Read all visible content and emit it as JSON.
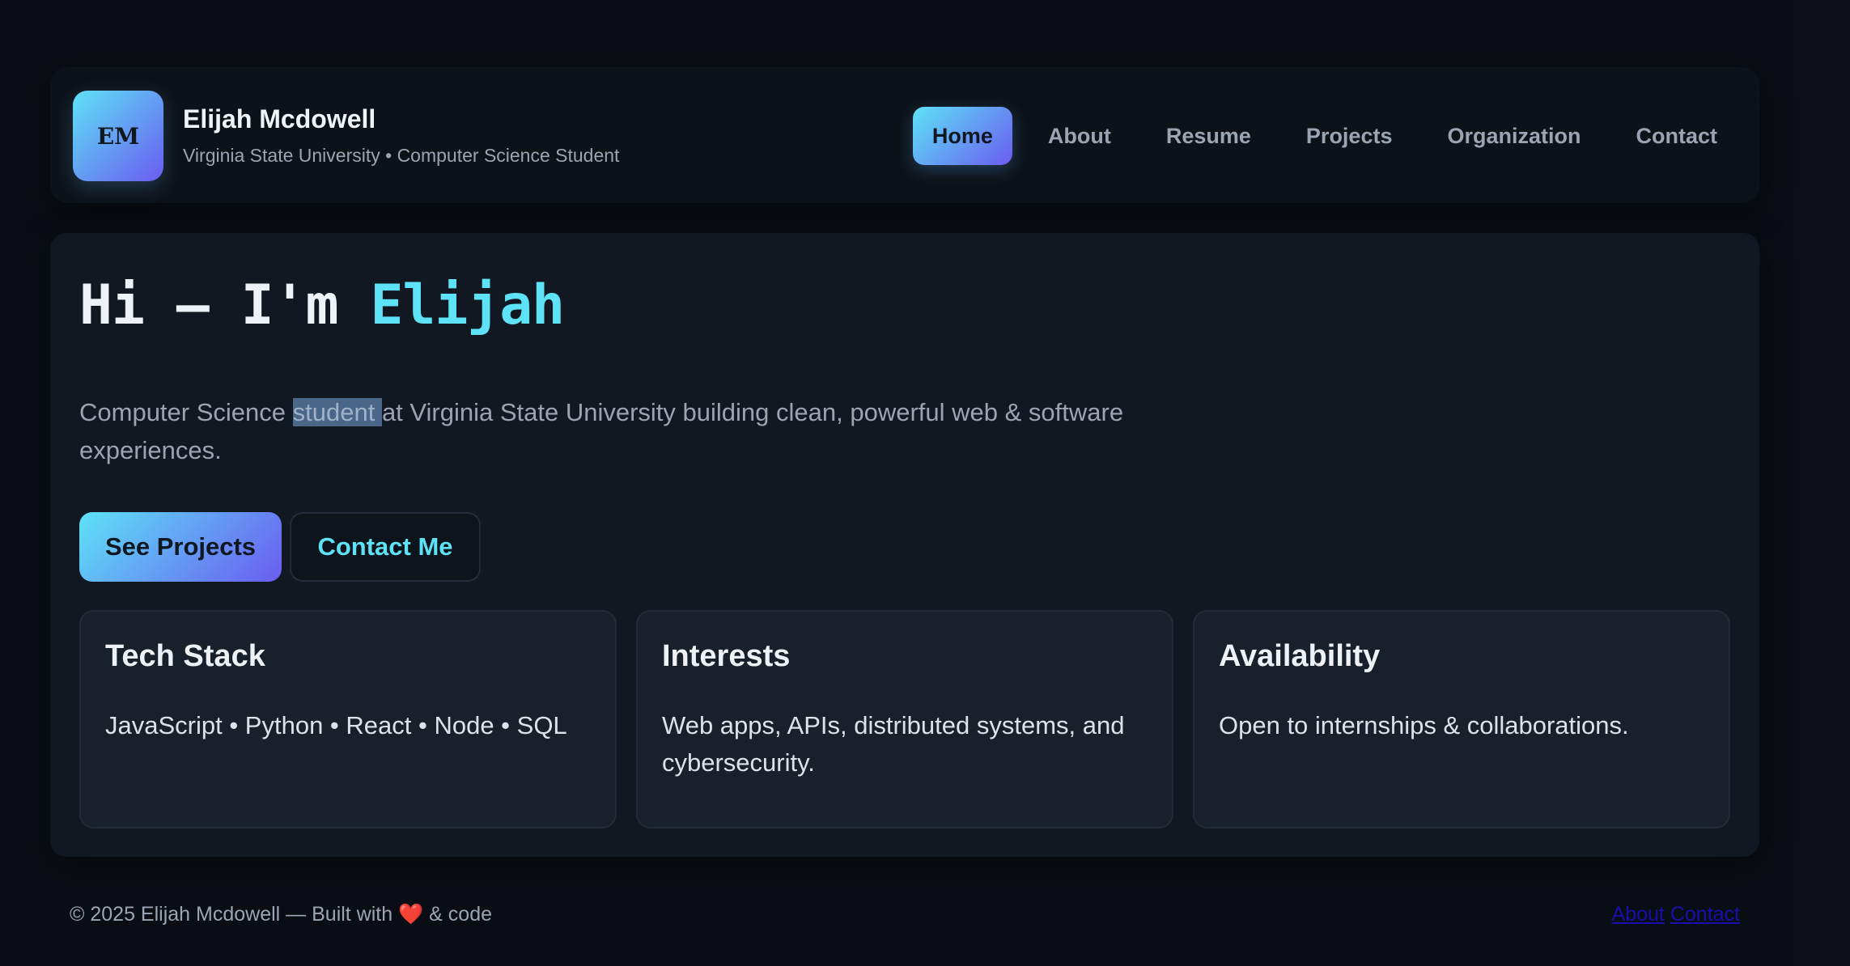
{
  "header": {
    "logo_initials": "EM",
    "name": "Elijah Mcdowell",
    "subtitle": "Virginia State University • Computer Science Student",
    "nav": [
      {
        "label": "Home",
        "active": true
      },
      {
        "label": "About"
      },
      {
        "label": "Resume"
      },
      {
        "label": "Projects"
      },
      {
        "label": "Organization"
      },
      {
        "label": "Contact"
      }
    ]
  },
  "hero": {
    "title_prefix": "Hi — I'm ",
    "title_name": "Elijah",
    "desc_before": "Computer Science ",
    "desc_highlight": "student ",
    "desc_after": "at Virginia State University building clean, powerful web & software experiences.",
    "primary_button": "See Projects",
    "secondary_button": "Contact Me"
  },
  "cards": [
    {
      "title": "Tech Stack",
      "body": "JavaScript • Python • React • Node • SQL"
    },
    {
      "title": "Interests",
      "body": "Web apps, APIs, distributed systems, and cybersecurity."
    },
    {
      "title": "Availability",
      "body": "Open to internships & collaborations."
    }
  ],
  "footer": {
    "text": "© 2025 Elijah Mcdowell — Built with ❤️ & code",
    "links": [
      "About",
      "Contact"
    ]
  },
  "colors": {
    "accent": "#5ee2f7",
    "accent_gradient_end": "#6a5cf0",
    "background": "#0a0e14",
    "card": "#17202b"
  }
}
